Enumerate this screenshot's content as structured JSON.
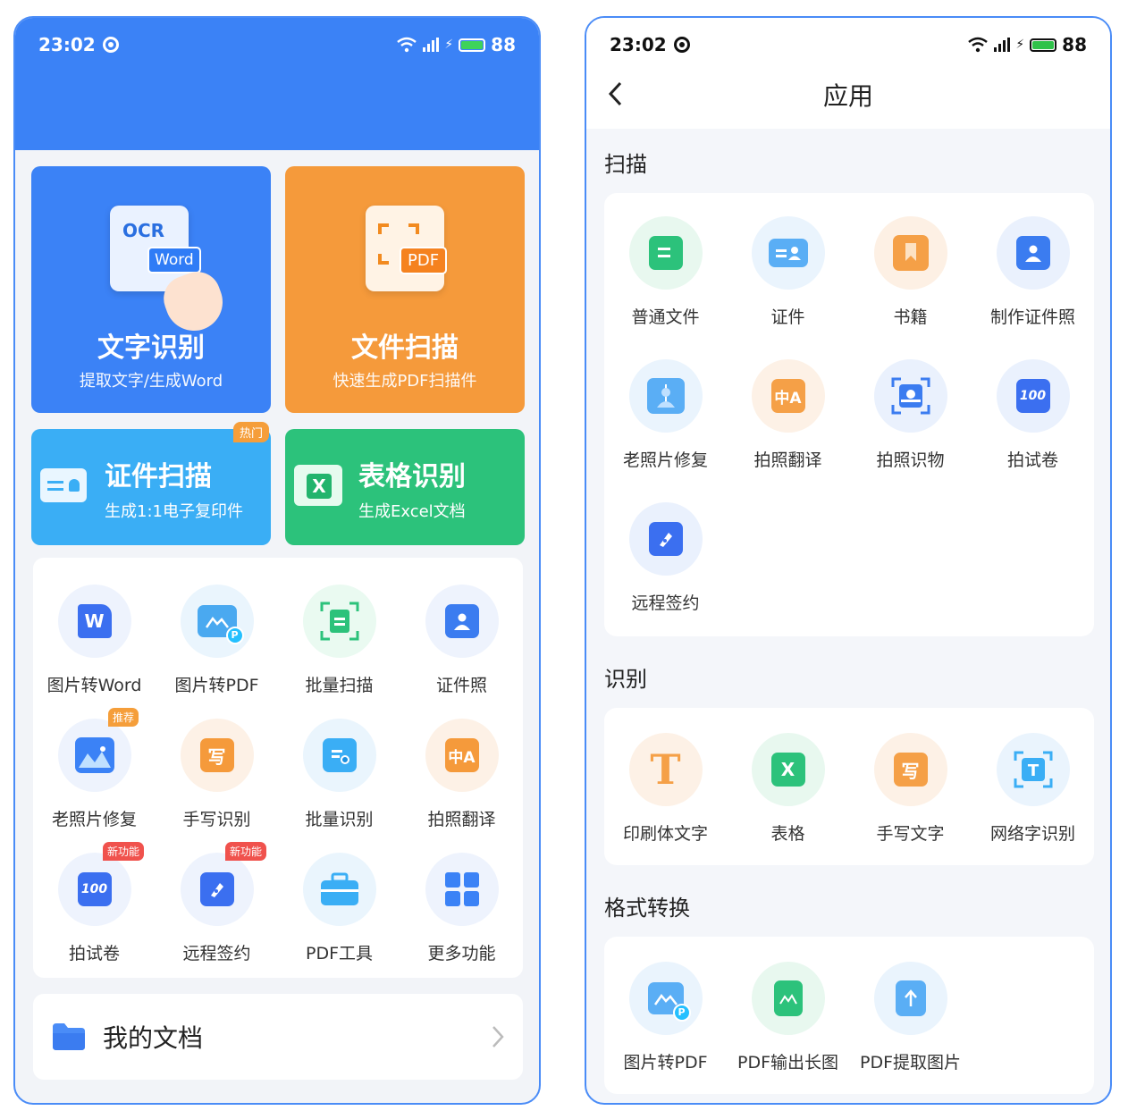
{
  "left": {
    "status": {
      "time": "23:02",
      "battery": "88"
    },
    "ocr_card": {
      "title": "文字识别",
      "sub": "提取文字/生成Word",
      "icon_text_ocr": "OCR",
      "icon_text_word": "Word"
    },
    "scan_card": {
      "title": "文件扫描",
      "sub": "快速生成PDF扫描件",
      "icon_text": "PDF"
    },
    "id_card": {
      "title": "证件扫描",
      "sub": "生成1:1电子复印件",
      "badge": "热门"
    },
    "table_card": {
      "title": "表格识别",
      "sub": "生成Excel文档"
    },
    "tools": [
      {
        "label": "图片转Word",
        "glyph": "W"
      },
      {
        "label": "图片转PDF",
        "glyph": "P"
      },
      {
        "label": "批量扫描",
        "glyph": ""
      },
      {
        "label": "证件照",
        "glyph": ""
      },
      {
        "label": "老照片修复",
        "glyph": "",
        "badge": "推荐"
      },
      {
        "label": "手写识别",
        "glyph": "写"
      },
      {
        "label": "批量识别",
        "glyph": ""
      },
      {
        "label": "拍照翻译",
        "glyph": "中A"
      },
      {
        "label": "拍试卷",
        "glyph": "100",
        "badge": "新功能"
      },
      {
        "label": "远程签约",
        "glyph": "",
        "badge": "新功能"
      },
      {
        "label": "PDF工具",
        "glyph": ""
      },
      {
        "label": "更多功能",
        "glyph": ""
      }
    ],
    "docs": {
      "label": "我的文档"
    }
  },
  "right": {
    "status": {
      "time": "23:02",
      "battery": "88"
    },
    "title": "应用",
    "sections": [
      {
        "title": "扫描",
        "items": [
          {
            "label": "普通文件"
          },
          {
            "label": "证件"
          },
          {
            "label": "书籍"
          },
          {
            "label": "制作证件照"
          },
          {
            "label": "老照片修复"
          },
          {
            "label": "拍照翻译"
          },
          {
            "label": "拍照识物"
          },
          {
            "label": "拍试卷"
          },
          {
            "label": "远程签约"
          }
        ]
      },
      {
        "title": "识别",
        "items": [
          {
            "label": "印刷体文字"
          },
          {
            "label": "表格"
          },
          {
            "label": "手写文字"
          },
          {
            "label": "网络字识别"
          }
        ]
      },
      {
        "title": "格式转换",
        "items": [
          {
            "label": "图片转PDF"
          },
          {
            "label": "PDF输出长图"
          },
          {
            "label": "PDF提取图片"
          }
        ]
      }
    ]
  },
  "colors": {
    "blue": "#3b82f6",
    "orange": "#f59a3b",
    "sky": "#3aaef5",
    "green": "#2cc27b"
  }
}
